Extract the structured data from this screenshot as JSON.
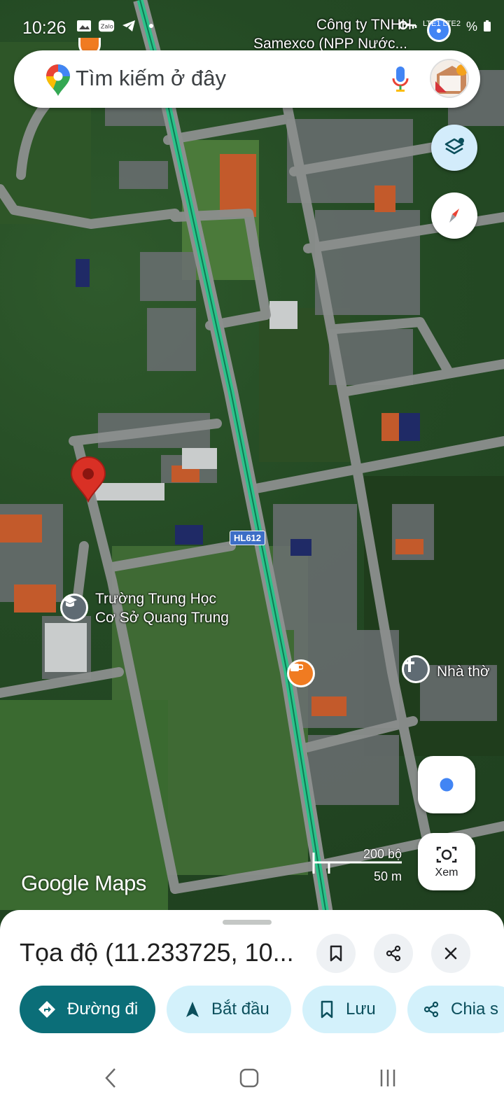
{
  "status_bar": {
    "time": "10:26",
    "left_icons": [
      "image-icon",
      "zalo-icon",
      "telegram-icon",
      "dot-icon"
    ],
    "right_text": "LTE1 LTE2",
    "battery": "%"
  },
  "search": {
    "placeholder": "Tìm kiếm ở đây"
  },
  "map": {
    "business_label_line1": "Công ty TNHH",
    "business_label_line2": "Samexco (NPP Nước...",
    "road_shield": "HL612",
    "school_label_line1": "Trường Trung Học",
    "school_label_line2": "Cơ Sở Quang Trung",
    "church_label": "Nhà thờ",
    "scale_large": "200 bộ",
    "scale_small": "50 m",
    "attribution": "Google Maps"
  },
  "buttons": {
    "lens_label": "Xem"
  },
  "place_sheet": {
    "title": "Tọa độ (11.233725, 10...",
    "actions": [
      {
        "label": "Đường đi",
        "icon": "directions-icon"
      },
      {
        "label": "Bắt đầu",
        "icon": "navigation-arrow-icon"
      },
      {
        "label": "Lưu",
        "icon": "bookmark-icon"
      },
      {
        "label": "Chia s",
        "icon": "share-icon"
      }
    ]
  },
  "colors": {
    "primary_chip": "#0b6e78",
    "secondary_chip": "#d3f1fb",
    "pin": "#d93025",
    "route": "#2bc38a"
  }
}
